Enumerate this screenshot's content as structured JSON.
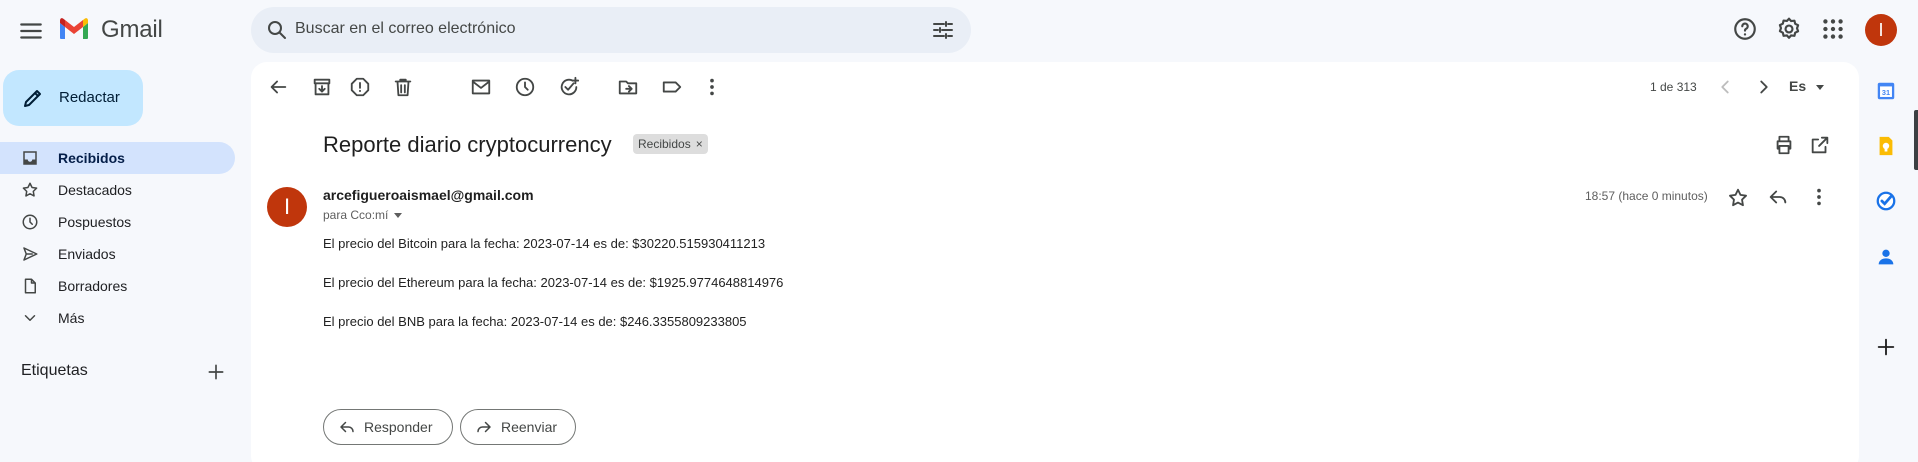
{
  "app": {
    "name": "Gmail",
    "user_initial": "I"
  },
  "search": {
    "placeholder": "Buscar en el correo electrónico"
  },
  "sidebar": {
    "compose_label": "Redactar",
    "items": [
      {
        "label": "Recibidos",
        "icon": "inbox-icon",
        "active": true
      },
      {
        "label": "Destacados",
        "icon": "star-icon"
      },
      {
        "label": "Pospuestos",
        "icon": "clock-icon"
      },
      {
        "label": "Enviados",
        "icon": "send-icon"
      },
      {
        "label": "Borradores",
        "icon": "draft-icon"
      },
      {
        "label": "Más",
        "icon": "chevron-down-icon"
      }
    ],
    "labels_heading": "Etiquetas"
  },
  "toolbar": {
    "pager": "1 de 313",
    "language": "Es"
  },
  "email": {
    "subject": "Reporte diario cryptocurrency",
    "label_chip": "Recibidos",
    "sender_initial": "I",
    "sender": "arcefigueroaismael@gmail.com",
    "recipients": "para Cco:mí",
    "time": "18:57 (hace 0 minutos)",
    "body": [
      "El precio del Bitcoin para la fecha: 2023-07-14 es de:  $30220.515930411213",
      "El precio del Ethereum para la fecha: 2023-07-14 es de:  $1925.9774648814976",
      "El precio del BNB para la fecha: 2023-07-14 es de:  $246.3355809233805"
    ],
    "reply_label": "Responder",
    "forward_label": "Reenviar"
  },
  "colors": {
    "accent": "#c2e7ff",
    "active_nav": "#d3e3fd",
    "avatar": "#c0360c",
    "background": "#f6f8fc"
  }
}
